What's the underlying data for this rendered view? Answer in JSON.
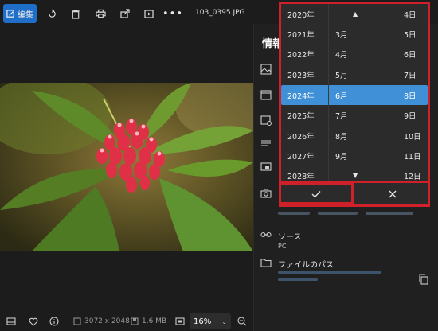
{
  "toolbar": {
    "edit_label": "編集",
    "filename": "103_0395.JPG"
  },
  "panel": {
    "title": "情報",
    "source_label": "ソース",
    "source_value": "PC",
    "filepath_label": "ファイルのパス"
  },
  "bottombar": {
    "dimensions": "3072 x 2048",
    "filesize": "1.6 MB",
    "zoom": "16%"
  },
  "picker": {
    "years": [
      "2020年",
      "2021年",
      "2022年",
      "2023年",
      "2024年",
      "2025年",
      "2026年",
      "2027年",
      "2028年"
    ],
    "months": [
      "",
      "3月",
      "4月",
      "5月",
      "6月",
      "7月",
      "8月",
      "9月",
      ""
    ],
    "days": [
      "4日",
      "5日",
      "6日",
      "7日",
      "8日",
      "9日",
      "10日",
      "11日",
      "12日"
    ],
    "selected_year": "2024年",
    "selected_month": "6月",
    "selected_day": "8日"
  },
  "colors": {
    "accent": "#3f90d7",
    "highlight_border": "#d0202a",
    "edit_button": "#1f6fc8"
  }
}
